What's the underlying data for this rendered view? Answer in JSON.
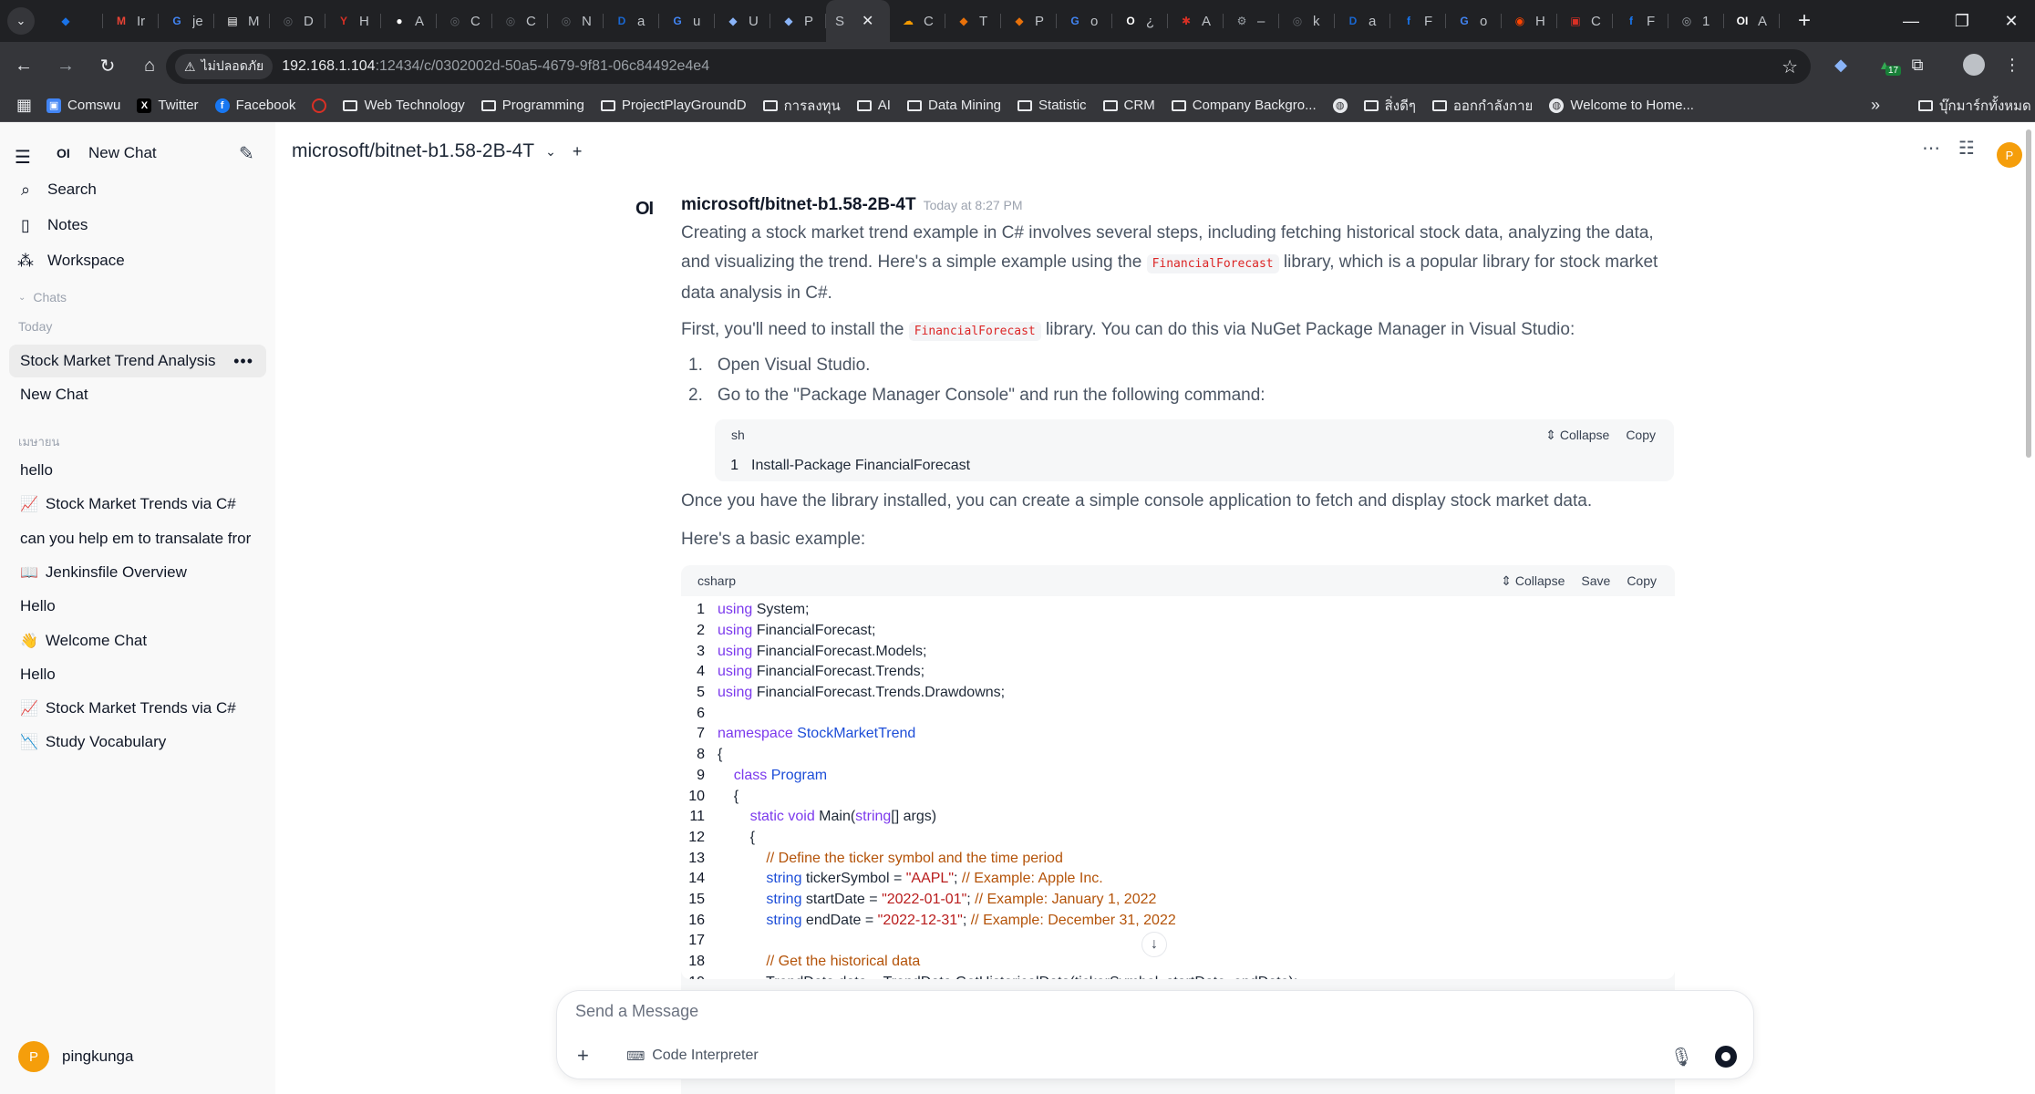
{
  "browser": {
    "tabs": [
      {
        "icon": "chrome-dropdown-icon",
        "label": ""
      },
      {
        "label": "",
        "color": "#1a73e8",
        "glyph": "◆"
      },
      {
        "label": "Ir",
        "color": "#ea4335",
        "glyph": "M"
      },
      {
        "label": "je",
        "color": "#4285f4",
        "glyph": "G"
      },
      {
        "label": "M",
        "color": "#ffffff",
        "glyph": "▤"
      },
      {
        "label": "D",
        "color": "#5f6368",
        "glyph": "◎"
      },
      {
        "label": "H",
        "color": "#d93025",
        "glyph": "Y"
      },
      {
        "label": "A",
        "color": "#ffffff",
        "glyph": "●"
      },
      {
        "label": "C",
        "color": "#5f6368",
        "glyph": "◎"
      },
      {
        "label": "C",
        "color": "#5f6368",
        "glyph": "◎"
      },
      {
        "label": "N",
        "color": "#5f6368",
        "glyph": "◎"
      },
      {
        "label": "a",
        "color": "#1967d2",
        "glyph": "D"
      },
      {
        "label": "u",
        "color": "#4285f4",
        "glyph": "G"
      },
      {
        "label": "U",
        "color": "#8ab4f8",
        "glyph": "◆"
      },
      {
        "label": "P",
        "color": "#8ab4f8",
        "glyph": "◆"
      },
      {
        "label": "S",
        "color": "#35363a",
        "glyph": "",
        "active": true
      },
      {
        "label": "C",
        "color": "#f29900",
        "glyph": "☁"
      },
      {
        "label": "T",
        "color": "#e8710a",
        "glyph": "◆"
      },
      {
        "label": "P",
        "color": "#e8710a",
        "glyph": "◆"
      },
      {
        "label": "o",
        "color": "#4285f4",
        "glyph": "G"
      },
      {
        "label": "¿",
        "color": "#ffffff",
        "glyph": "O"
      },
      {
        "label": "A",
        "color": "#d93025",
        "glyph": "✱"
      },
      {
        "label": "–",
        "color": "#9aa0a6",
        "glyph": "⚙"
      },
      {
        "label": "k",
        "color": "#5f6368",
        "glyph": "◎"
      },
      {
        "label": "a",
        "color": "#1967d2",
        "glyph": "D"
      },
      {
        "label": "F",
        "color": "#1877f2",
        "glyph": "f"
      },
      {
        "label": "o",
        "color": "#4285f4",
        "glyph": "G"
      },
      {
        "label": "H",
        "color": "#ff4500",
        "glyph": "◉"
      },
      {
        "label": "C",
        "color": "#d93025",
        "glyph": "▣"
      },
      {
        "label": "F",
        "color": "#1877f2",
        "glyph": "f"
      },
      {
        "label": "1",
        "color": "#9aa0a6",
        "glyph": "◎"
      },
      {
        "label": "A",
        "color": "#ffffff",
        "glyph": "OI"
      }
    ],
    "active_tab_label": "S",
    "security_label": "ไม่ปลอดภัย",
    "url_host": "192.168.1.104",
    "url_path": ":12434/c/0302002d-50a5-4679-9f81-06c84492e4e4",
    "extension_badge": "17",
    "bookmarks": [
      {
        "label": "Comswu",
        "kind": "site",
        "color": "#4285f4"
      },
      {
        "label": "Twitter",
        "kind": "x"
      },
      {
        "label": "Facebook",
        "kind": "fb"
      },
      {
        "label": "",
        "kind": "red"
      },
      {
        "label": "Web Technology",
        "kind": "folder"
      },
      {
        "label": "Programming",
        "kind": "folder"
      },
      {
        "label": "ProjectPlayGroundD",
        "kind": "folder"
      },
      {
        "label": "การลงทุน",
        "kind": "folder"
      },
      {
        "label": "AI",
        "kind": "folder"
      },
      {
        "label": "Data Mining",
        "kind": "folder"
      },
      {
        "label": "Statistic",
        "kind": "folder"
      },
      {
        "label": "CRM",
        "kind": "folder"
      },
      {
        "label": "Company Backgro...",
        "kind": "folder"
      },
      {
        "label": "",
        "kind": "globe"
      },
      {
        "label": "สิ่งดีๆ",
        "kind": "folder"
      },
      {
        "label": "ออกกำลังกาย",
        "kind": "folder"
      },
      {
        "label": "Welcome to Home...",
        "kind": "globe"
      }
    ],
    "all_bookmarks_label": "บุ๊กมาร์กทั้งหมด"
  },
  "sidebar": {
    "brand": "OI",
    "new_chat": "New Chat",
    "search": "Search",
    "notes": "Notes",
    "workspace": "Workspace",
    "chats_section": "Chats",
    "today_label": "Today",
    "today_items": [
      {
        "label": "Stock Market Trend Analysis",
        "emoji": ""
      },
      {
        "label": "New Chat",
        "emoji": ""
      }
    ],
    "older_label": "เมษายน",
    "older_items": [
      {
        "label": "hello",
        "emoji": ""
      },
      {
        "label": "Stock Market Trends via C#",
        "emoji": "📈"
      },
      {
        "label": "can you help em to transalate fror",
        "emoji": ""
      },
      {
        "label": "Jenkinsfile Overview",
        "emoji": "📖"
      },
      {
        "label": "Hello",
        "emoji": ""
      },
      {
        "label": "Welcome Chat",
        "emoji": "👋"
      },
      {
        "label": "Hello",
        "emoji": ""
      },
      {
        "label": "Stock Market Trends via C#",
        "emoji": "📈"
      },
      {
        "label": "Study Vocabulary",
        "emoji": "📉"
      }
    ],
    "user_initial": "P",
    "user_name": "pingkunga"
  },
  "header": {
    "model": "microsoft/bitnet-b1.58-2B-4T",
    "user_initial": "P"
  },
  "message": {
    "logo": "OI",
    "model_name": "microsoft/bitnet-b1.58-2B-4T",
    "time": "Today at 8:27 PM",
    "p1_a": "Creating a stock market trend example in C# involves several steps, including fetching historical stock data, analyzing the data, and visualizing the trend. Here's a simple example using the ",
    "p1_code": "FinancialForecast",
    "p1_b": " library, which is a popular library for stock market data analysis in C#.",
    "p2_a": "First, you'll need to install the ",
    "p2_code": "FinancialForecast",
    "p2_b": " library. You can do this via NuGet Package Manager in Visual Studio:",
    "steps": [
      {
        "num": "1.",
        "text": "Open Visual Studio."
      },
      {
        "num": "2.",
        "text": "Go to the \"Package Manager Console\" and run the following command:"
      }
    ],
    "code1": {
      "lang": "sh",
      "collapse": "Collapse",
      "copy": "Copy",
      "lines": [
        "Install-Package FinancialForecast"
      ]
    },
    "p3": "Once you have the library installed, you can create a simple console application to fetch and display stock market data.",
    "p4": "Here's a basic example:",
    "code2": {
      "lang": "csharp",
      "collapse": "Collapse",
      "save": "Save",
      "copy": "Copy",
      "lines": [
        [
          {
            "c": "kw",
            "t": "using"
          },
          {
            "c": "pl",
            "t": " System;"
          }
        ],
        [
          {
            "c": "kw",
            "t": "using"
          },
          {
            "c": "pl",
            "t": " FinancialForecast;"
          }
        ],
        [
          {
            "c": "kw",
            "t": "using"
          },
          {
            "c": "pl",
            "t": " FinancialForecast.Models;"
          }
        ],
        [
          {
            "c": "kw",
            "t": "using"
          },
          {
            "c": "pl",
            "t": " FinancialForecast.Trends;"
          }
        ],
        [
          {
            "c": "kw",
            "t": "using"
          },
          {
            "c": "pl",
            "t": " FinancialForecast.Trends.Drawdowns;"
          }
        ],
        [],
        [
          {
            "c": "kw",
            "t": "namespace"
          },
          {
            "c": "pl",
            "t": " "
          },
          {
            "c": "ty",
            "t": "StockMarketTrend"
          }
        ],
        [
          {
            "c": "pl",
            "t": "{"
          }
        ],
        [
          {
            "c": "pl",
            "t": "    "
          },
          {
            "c": "kw",
            "t": "class"
          },
          {
            "c": "pl",
            "t": " "
          },
          {
            "c": "ty",
            "t": "Program"
          }
        ],
        [
          {
            "c": "pl",
            "t": "    {"
          }
        ],
        [
          {
            "c": "pl",
            "t": "        "
          },
          {
            "c": "kw",
            "t": "static"
          },
          {
            "c": "pl",
            "t": " "
          },
          {
            "c": "kw",
            "t": "void"
          },
          {
            "c": "pl",
            "t": " Main("
          },
          {
            "c": "kw",
            "t": "string"
          },
          {
            "c": "pl",
            "t": "[] args)"
          }
        ],
        [
          {
            "c": "pl",
            "t": "        {"
          }
        ],
        [
          {
            "c": "pl",
            "t": "            "
          },
          {
            "c": "cm",
            "t": "// Define the ticker symbol and the time period"
          }
        ],
        [
          {
            "c": "pl",
            "t": "            "
          },
          {
            "c": "ty",
            "t": "string"
          },
          {
            "c": "pl",
            "t": " tickerSymbol = "
          },
          {
            "c": "st",
            "t": "\"AAPL\""
          },
          {
            "c": "pl",
            "t": "; "
          },
          {
            "c": "cm",
            "t": "// Example: Apple Inc."
          }
        ],
        [
          {
            "c": "pl",
            "t": "            "
          },
          {
            "c": "ty",
            "t": "string"
          },
          {
            "c": "pl",
            "t": " startDate = "
          },
          {
            "c": "st",
            "t": "\"2022-01-01\""
          },
          {
            "c": "pl",
            "t": "; "
          },
          {
            "c": "cm",
            "t": "// Example: January 1, 2022"
          }
        ],
        [
          {
            "c": "pl",
            "t": "            "
          },
          {
            "c": "ty",
            "t": "string"
          },
          {
            "c": "pl",
            "t": " endDate = "
          },
          {
            "c": "st",
            "t": "\"2022-12-31\""
          },
          {
            "c": "pl",
            "t": "; "
          },
          {
            "c": "cm",
            "t": "// Example: December 31, 2022"
          }
        ],
        [],
        [
          {
            "c": "pl",
            "t": "            "
          },
          {
            "c": "cm",
            "t": "// Get the historical data"
          }
        ],
        [
          {
            "c": "pl",
            "t": "            TrendData data = TrendData.GetHistoricalData(tickerSymbol, startDate, endDate);"
          }
        ]
      ]
    }
  },
  "composer": {
    "placeholder": "Send a Message",
    "tool_label": "Code Interpreter"
  }
}
